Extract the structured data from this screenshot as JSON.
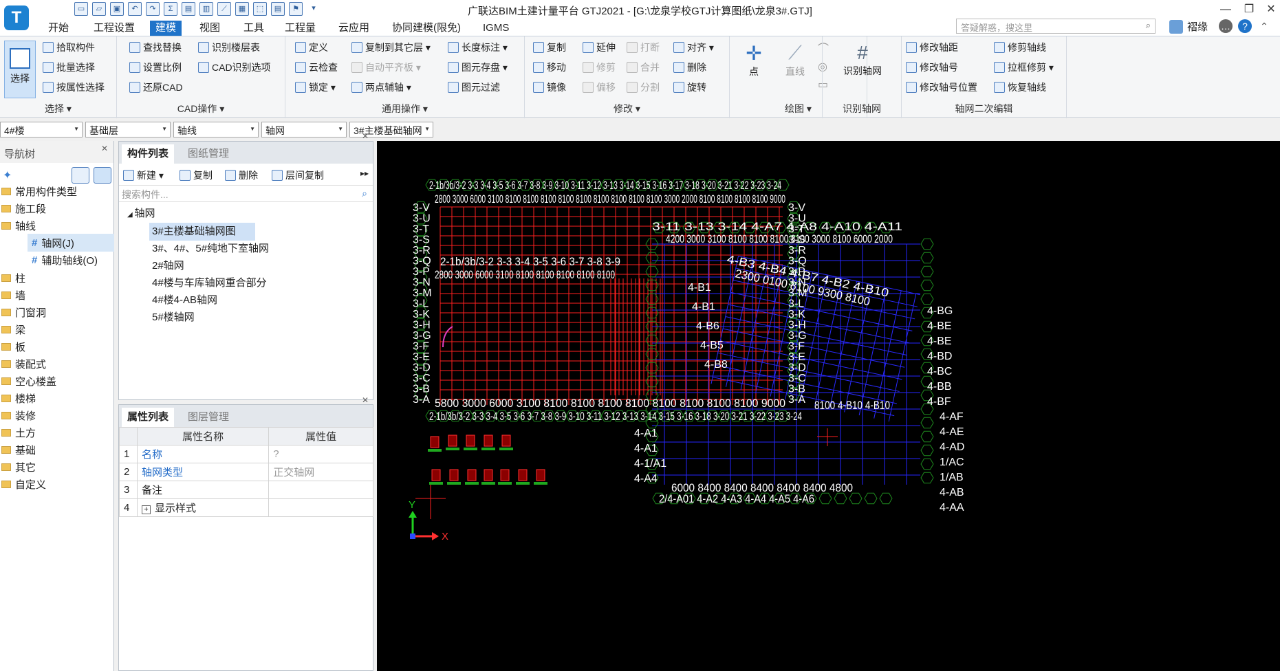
{
  "window": {
    "logo_letter": "T",
    "title": "广联达BIM土建计量平台 GTJ2021 - [G:\\龙泉学校GTJ计算图纸\\龙泉3#.GTJ]",
    "minimize": "—",
    "maximize": "❐",
    "close": "✕"
  },
  "menu": {
    "tabs": [
      "开始",
      "工程设置",
      "建模",
      "视图",
      "工具",
      "工程量",
      "云应用",
      "协同建模(限免)",
      "IGMS"
    ],
    "active_tab": "建模",
    "search_placeholder": "答疑解惑，搜这里",
    "user_name": "褶缘"
  },
  "ribbon": {
    "select": {
      "big_button": "选择",
      "buttons": [
        "拾取构件",
        "批量选择",
        "按属性选择"
      ],
      "group_label": "选择 ▾"
    },
    "cad": {
      "buttons": [
        "查找替换",
        "识别楼层表",
        "设置比例",
        "CAD识别选项",
        "还原CAD"
      ],
      "group_label": "CAD操作 ▾"
    },
    "common": {
      "buttons": [
        "定义",
        "复制到其它层 ▾",
        "长度标注 ▾",
        "云检查",
        "自动平齐板 ▾",
        "图元存盘 ▾",
        "锁定 ▾",
        "两点辅轴 ▾",
        "图元过滤"
      ],
      "group_label": "通用操作 ▾"
    },
    "modify": {
      "buttons": [
        "复制",
        "延伸",
        "打断",
        "对齐 ▾",
        "移动",
        "修剪",
        "合并",
        "删除",
        "镜像",
        "偏移",
        "分割",
        "旋转"
      ],
      "group_label": "修改 ▾"
    },
    "draw": {
      "buttons": [
        "点",
        "直线"
      ],
      "group_label": "绘图 ▾"
    },
    "recognize": {
      "button": "识别轴网",
      "group_label": "识别轴网"
    },
    "axis_edit": {
      "buttons": [
        "修改轴距",
        "修剪轴线",
        "修改轴号",
        "拉框修剪 ▾",
        "修改轴号位置",
        "恢复轴线"
      ],
      "group_label": "轴网二次编辑"
    }
  },
  "selectors": [
    "4#楼",
    "基础层",
    "轴线",
    "轴网",
    "3#主楼基础轴网"
  ],
  "nav": {
    "header": "导航树",
    "items": [
      "常用构件类型",
      "施工段",
      "轴线",
      "轴网(J)",
      "辅助轴线(O)",
      "柱",
      "墙",
      "门窗洞",
      "梁",
      "板",
      "装配式",
      "空心楼盖",
      "楼梯",
      "装修",
      "土方",
      "基础",
      "其它",
      "自定义"
    ]
  },
  "components": {
    "tabs": [
      "构件列表",
      "图纸管理"
    ],
    "toolbar": [
      "新建 ▾",
      "复制",
      "删除",
      "层间复制"
    ],
    "search_placeholder": "搜索构件...",
    "root": "轴网",
    "items": [
      "3#主楼基础轴网图",
      "3#、4#、5#纯地下室轴网",
      "2#轴网",
      "4#楼与车库轴网重合部分",
      "4#楼4-AB轴网",
      "5#楼轴网"
    ]
  },
  "properties": {
    "tabs": [
      "属性列表",
      "图层管理"
    ],
    "headers": [
      "属性名称",
      "属性值"
    ],
    "rows": [
      {
        "num": "1",
        "name": "名称",
        "value": "?"
      },
      {
        "num": "2",
        "name": "轴网类型",
        "value": "正交轴网"
      },
      {
        "num": "3",
        "name": "备注",
        "value": ""
      },
      {
        "num": "4",
        "name": "显示样式",
        "value": ""
      }
    ]
  },
  "canvas": {
    "axis_labels": {
      "top_row": "2-1b/3b/3-2 3-3 3-4 3-5 3-6 3-7 3-8 3-9 3-10 3-11 3-12 3-13 3-14 3-15 3-16 3-17 3-18 3-20 3-21 3-22 3-23 3-24",
      "top_dims": "2800 3000 6000 3100 8100 8100 8100 8100 8100 8100 8100 8100 8100 3000 2000 8100 8100 8100 8100 9000",
      "mid_row": "2-1b/3b/3-2 3-3 3-4 3-5 3-6 3-7 3-8 3-9",
      "mid_dims": "2800 3000 6000 3100 8100 8100 8100 8100 8100",
      "bottom_row": "2-1b/3b/3-2 3-3 3-4 3-5 3-6 3-7 3-8 3-9 3-10 3-11 3-12 3-13 3-14 3-15 3-16 3-18 3-20 3-21 3-22 3-23 3-24",
      "bottom_dims": "5800 3000 6000 3100 8100 8100 8100 8100 8100 8100 8100 8100 9000",
      "right_rows": [
        "3-V",
        "3-U",
        "3-T",
        "3-S",
        "3-R",
        "3-Q",
        "3-P",
        "3-N",
        "3-M",
        "3-L",
        "3-K",
        "3-H",
        "3-G",
        "3-F",
        "3-E",
        "3-D",
        "3-C",
        "3-B",
        "3-A"
      ],
      "grid4_top": "3-11 3-13 3-14 4-A7 4-A8 4-A10 4-A11",
      "grid4_dims": "4200 3000 3100 8100 8100 8100 8100 3000 8100 6000 2000",
      "grid4_bottom": "6000 8400 8400 8400 8400 8400 4800",
      "grid4_bottom_axes": "2/4-A01 4-A2 4-A3 4-A4 4-A5 4-A6",
      "grid4_left": [
        "4-A1",
        "4-A1",
        "4-1/A1",
        "4-A4"
      ],
      "rotated_left": [
        "4-B1",
        "4-B1",
        "4-B6",
        "4-B5",
        "4-B8"
      ],
      "rotated_top": "4-B3 4-B4 4-B7 4-B2 4-B10",
      "rotated_right": [
        "4-BG",
        "4-BE",
        "4-BE",
        "4-BD",
        "4-BC",
        "4-BB",
        "4-BF",
        "4-AF",
        "4-AE",
        "4-AD",
        "1/AC",
        "1/AB",
        "4-AB",
        "4-AA"
      ],
      "rotated_bottom": "8100 4-B10 4-B10",
      "rot_dims": "2300 0100 8100 9300 8100"
    },
    "axis_x": "X",
    "axis_y": "Y"
  }
}
